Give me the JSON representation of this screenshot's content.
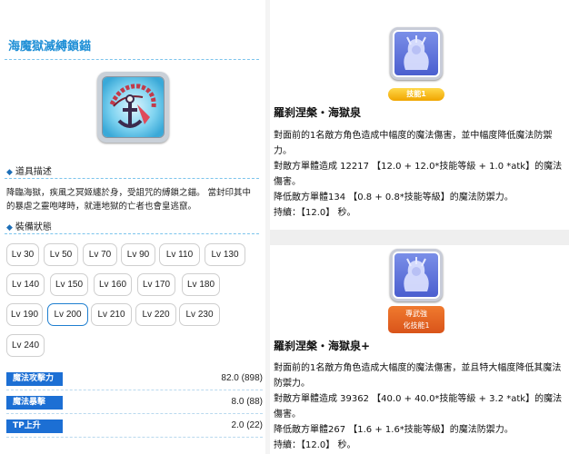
{
  "item": {
    "title": "海魔獄滅縛鎖錨",
    "desc_heading": "道具描述",
    "description": "降臨海獄，疾風之冥姬纏於身，受詛咒的縛鎖之錨。 當封印其中的暴虐之靈咆哮時，就連地獄的亡者也會皇逃竄。",
    "status_heading": "裝備狀態"
  },
  "levels": [
    "Lv 30",
    "Lv 50",
    "Lv 70",
    "Lv 90",
    "Lv 110",
    "Lv 130",
    "Lv 140",
    "Lv 150",
    "Lv 160",
    "Lv 170",
    "Lv 180",
    "Lv 190",
    "Lv 200",
    "Lv 210",
    "Lv 220",
    "Lv 230",
    "Lv 240"
  ],
  "selected_level": "Lv 200",
  "stats": [
    {
      "label": "魔法攻擊力",
      "value": "82.0 (898)"
    },
    {
      "label": "魔法暴擊",
      "value": "8.0 (88)"
    },
    {
      "label": "TP上升",
      "value": "2.0 (22)"
    }
  ],
  "skills": [
    {
      "badge": "技能1",
      "name": "羅刹涅槃・海獄泉",
      "lines": [
        "對面前的1名敵方角色造成中幅度的魔法傷害，並中幅度降低魔法防禦力。",
        "對敵方單體造成 12217 【12.0 + 12.0*技能等級 + 1.0 *atk】的魔法傷害。",
        "降低敵方單體134 【0.8 + 0.8*技能等級】的魔法防禦力。",
        "持續：【12.0】 秒。"
      ]
    },
    {
      "badge_line1": "專武強",
      "badge_line2": "化技能1",
      "name": "羅刹涅槃・海獄泉+",
      "lines": [
        "對面前的1名敵方角色造成大幅度的魔法傷害，並且特大幅度降低其魔法防禦力。",
        "對敵方單體造成 39362 【40.0 + 40.0*技能等級 + 3.2 *atk】的魔法傷害。",
        "降低敵方單體267 【1.6 + 1.6*技能等級】的魔法防禦力。",
        "持續：【12.0】 秒。"
      ]
    }
  ],
  "colors": {
    "accent": "#1f8fd6",
    "stat_label_bg": "#1c6fd4",
    "badge_yellow": "#f5b800",
    "badge_orange": "#e0601f"
  },
  "icons": {
    "item": "chain-anchor-icon",
    "skill": "ghost-silhouette-icon",
    "bullet": "diamond-icon"
  }
}
